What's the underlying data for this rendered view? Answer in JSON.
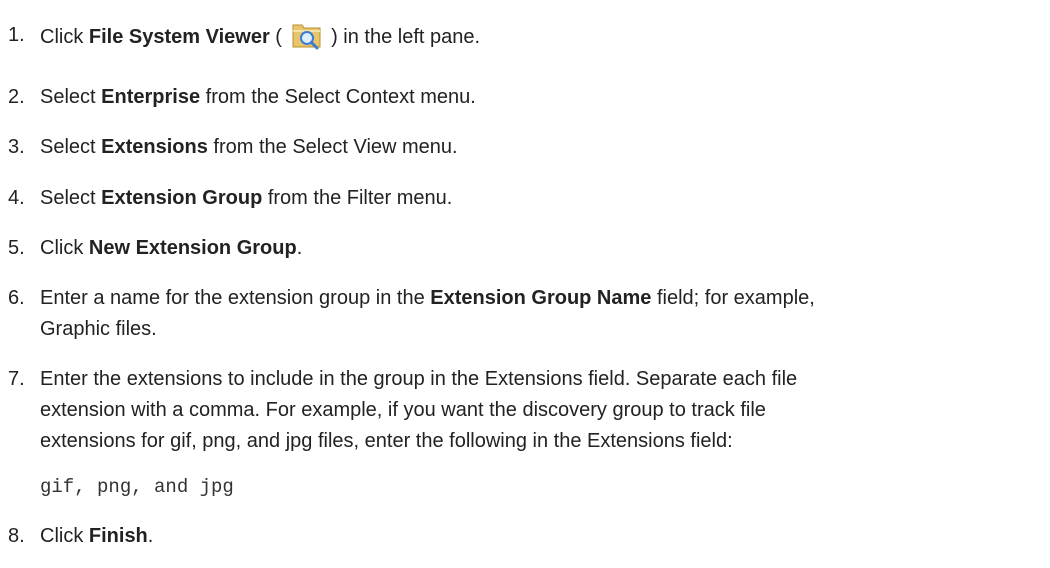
{
  "steps": [
    {
      "number": "1.",
      "pre": "Click ",
      "bold": "File System Viewer",
      "post": " ) in the left pane.",
      "icon": "folder-search-icon",
      "paren": " ("
    },
    {
      "number": "2.",
      "pre": "Select ",
      "bold": "Enterprise",
      "post": " from the Select Context menu."
    },
    {
      "number": "3.",
      "pre": "Select ",
      "bold": "Extensions",
      "post": " from the Select View menu."
    },
    {
      "number": "4.",
      "pre": "Select ",
      "bold": "Extension Group",
      "post": " from the Filter menu."
    },
    {
      "number": "5.",
      "pre": "Click ",
      "bold": "New Extension Group",
      "post": "."
    },
    {
      "number": "6.",
      "pre": "Enter a name for the extension group in the ",
      "bold": "Extension Group Name",
      "post": " field; for example,",
      "line2": "Graphic files."
    },
    {
      "number": "7.",
      "line1": "Enter the extensions to include in the group in the Extensions field. Separate each file",
      "line2": "extension with a comma. For example, if you want the discovery group to track file",
      "line3": "extensions for gif, png, and jpg files, enter the following in the Extensions field:",
      "code": "gif, png, and jpg"
    },
    {
      "number": "8.",
      "pre": "Click ",
      "bold": "Finish",
      "post": "."
    }
  ],
  "colors": {
    "text": "#222222",
    "folder": "#e8c56a",
    "magnifier": "#3a7bd5"
  }
}
